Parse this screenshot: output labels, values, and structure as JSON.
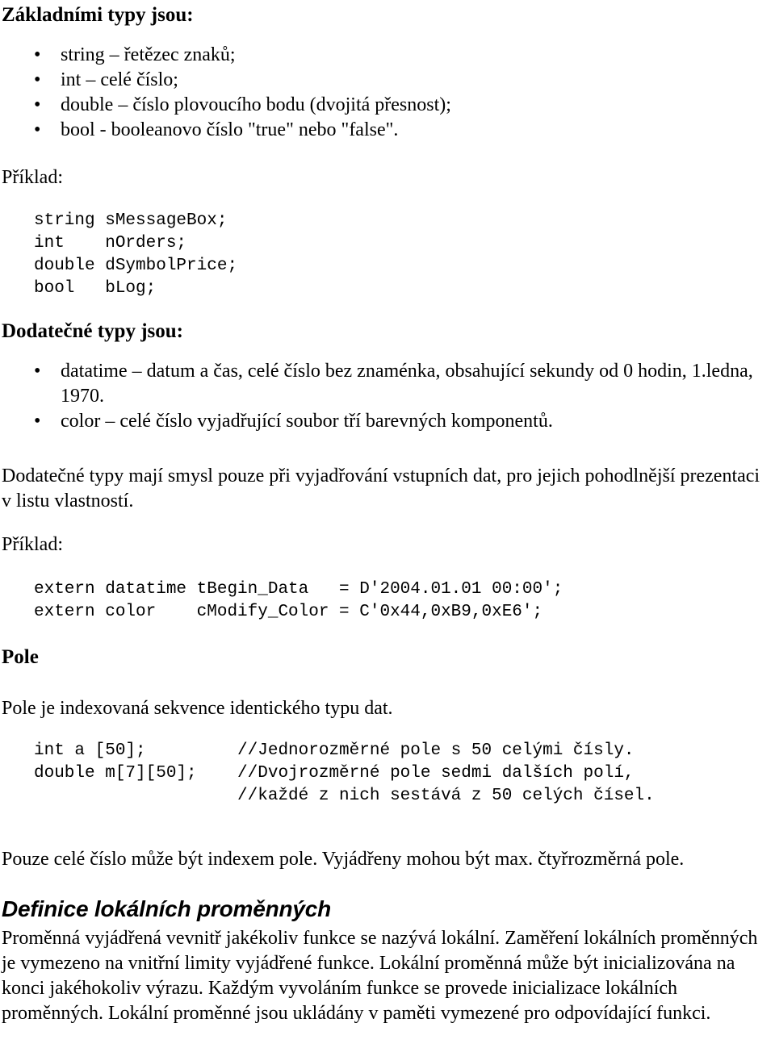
{
  "document": {
    "language": "cs",
    "background_color": "#ffffff",
    "text_color": "#000000",
    "bullet_glyph": "•"
  },
  "section_basic_types": {
    "heading": "Základními typy jsou:",
    "items": [
      "string – řetězec znaků;",
      "int – celé číslo;",
      "double – číslo plovoucího bodu (dvojitá přesnost);",
      "bool - booleanovo číslo \"true\" nebo \"false\"."
    ],
    "example_label": "Příklad:",
    "code": "string sMessageBox;\nint    nOrders;\ndouble dSymbolPrice;\nbool   bLog;"
  },
  "section_additional_types": {
    "heading": "Dodatečné typy jsou:",
    "items": [
      "datatime – datum a čas, celé číslo bez znaménka, obsahující sekundy od 0 hodin, 1.ledna, 1970.",
      "color – celé číslo vyjadřující soubor tří barevných komponentů."
    ],
    "paragraph": "Dodatečné typy mají smysl pouze při vyjadřování vstupních dat, pro jejich pohodlnější prezentaci v listu vlastností.",
    "example_label": "Příklad:",
    "code": "extern datatime tBegin_Data   = D'2004.01.01 00:00';\nextern color    cModify_Color = C'0x44,0xB9,0xE6';"
  },
  "section_arrays": {
    "heading": "Pole",
    "intro": "Pole je indexovaná sekvence identického typu dat.",
    "code": "int a [50];         //Jednorozměrné pole s 50 celými čísly.\ndouble m[7][50];    //Dvojrozměrné pole sedmi dalších polí,\n                    //každé z nich sestává z 50 celých čísel.",
    "outro": "Pouze celé číslo může být indexem pole. Vyjádřeny mohou být max. čtyřrozměrná pole."
  },
  "section_local_variables": {
    "heading": "Definice lokálních proměnných",
    "paragraph": "Proměnná vyjádřená vevnitř jakékoliv funkce se nazývá lokální. Zaměření lokálních proměnných je vymezeno na vnitřní limity vyjádřené funkce. Lokální proměnná může být inicializována na konci jakéhokoliv výrazu. Každým vyvoláním funkce se provede inicializace lokálních proměnných. Lokální proměnné jsou ukládány v paměti vymezené pro odpovídající funkci."
  }
}
